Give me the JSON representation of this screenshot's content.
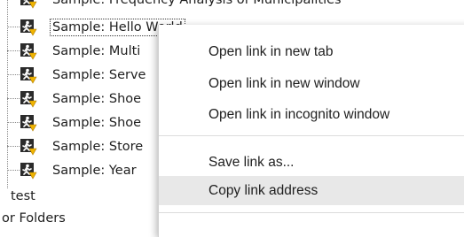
{
  "tree": {
    "items": [
      {
        "label": "Sample: Frequency Analysis of Municipalities"
      },
      {
        "label": "Sample: Hello World"
      },
      {
        "label": "Sample: Multi"
      },
      {
        "label": "Sample: Serve"
      },
      {
        "label": "Sample: Shoe"
      },
      {
        "label": "Sample: Shoe"
      },
      {
        "label": "Sample: Store"
      },
      {
        "label": "Sample: Year"
      }
    ],
    "test_label": "test",
    "folders_label": "or Folders"
  },
  "context_menu": {
    "items": [
      {
        "label": "Open link in new tab"
      },
      {
        "label": "Open link in new window"
      },
      {
        "label": "Open link in incognito window"
      },
      {
        "label": "Save link as..."
      },
      {
        "label": "Copy link address"
      }
    ]
  },
  "colors": {
    "icon_bg": "#2b2b2b",
    "icon_figure": "#ffffff",
    "icon_arrow": "#f0b400",
    "menu_hover": "#e8e8e8"
  }
}
